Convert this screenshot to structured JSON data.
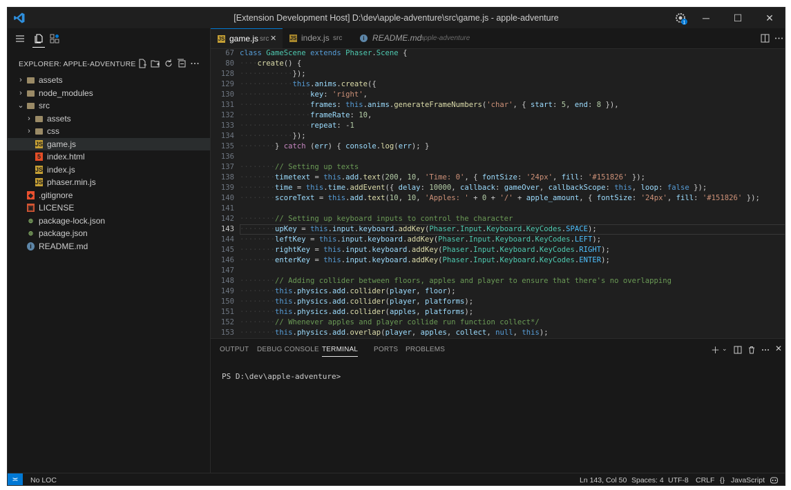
{
  "window": {
    "title": "[Extension Development Host] D:\\dev\\apple-adventure\\src\\game.js - apple-adventure",
    "controls": {
      "minimize": "─",
      "maximize": "☐",
      "close": "✕"
    },
    "accent": "#0078d4"
  },
  "explorer": {
    "title": "EXPLORER: APPLE-ADVENTURE",
    "tree": [
      {
        "label": "assets",
        "type": "folder",
        "depth": 0,
        "expanded": false
      },
      {
        "label": "node_modules",
        "type": "folder",
        "depth": 0,
        "expanded": false
      },
      {
        "label": "src",
        "type": "folder",
        "depth": 0,
        "expanded": true
      },
      {
        "label": "assets",
        "type": "folder",
        "depth": 1,
        "expanded": false
      },
      {
        "label": "css",
        "type": "folder",
        "depth": 1,
        "expanded": false
      },
      {
        "label": "game.js",
        "type": "js",
        "depth": 1,
        "selected": true
      },
      {
        "label": "index.html",
        "type": "html",
        "depth": 1
      },
      {
        "label": "index.js",
        "type": "js",
        "depth": 1
      },
      {
        "label": "phaser.min.js",
        "type": "js",
        "depth": 1
      },
      {
        "label": ".gitignore",
        "type": "git",
        "depth": 0
      },
      {
        "label": "LICENSE",
        "type": "license",
        "depth": 0
      },
      {
        "label": "package-lock.json",
        "type": "json",
        "depth": 0
      },
      {
        "label": "package.json",
        "type": "json",
        "depth": 0
      },
      {
        "label": "README.md",
        "type": "info",
        "depth": 0
      }
    ]
  },
  "tabs": [
    {
      "label": "game.js",
      "desc": "src",
      "active": true,
      "close": "✕"
    },
    {
      "label": "index.js",
      "desc": "src",
      "active": false
    },
    {
      "label": "README.md",
      "desc": "apple-adventure",
      "active": false
    }
  ],
  "editor": {
    "current_line": "143",
    "lines": [
      {
        "n": "67",
        "text": "class GameScene extends Phaser.Scene {"
      },
      {
        "n": "80",
        "text": "    create() {"
      },
      {
        "n": "128",
        "text": "            });"
      },
      {
        "n": "129",
        "text": "            this.anims.create({"
      },
      {
        "n": "130",
        "text": "                key: 'right',"
      },
      {
        "n": "131",
        "text": "                frames: this.anims.generateFrameNumbers('char', { start: 5, end: 8 }),"
      },
      {
        "n": "132",
        "text": "                frameRate: 10,"
      },
      {
        "n": "133",
        "text": "                repeat: -1"
      },
      {
        "n": "134",
        "text": "            });"
      },
      {
        "n": "135",
        "text": "        } catch (err) { console.log(err); }"
      },
      {
        "n": "136",
        "text": ""
      },
      {
        "n": "137",
        "text": "        // Setting up texts"
      },
      {
        "n": "138",
        "text": "        timetext = this.add.text(200, 10, 'Time: 0', { fontSize: '24px', fill: '#151826' });"
      },
      {
        "n": "139",
        "text": "        time = this.time.addEvent({ delay: 10000, callback: gameOver, callbackScope: this, loop: false });"
      },
      {
        "n": "140",
        "text": "        scoreText = this.add.text(10, 10, 'Apples: ' + 0 + '/' + apple_amount, { fontSize: '24px', fill: '#151826' });"
      },
      {
        "n": "141",
        "text": ""
      },
      {
        "n": "142",
        "text": "        // Setting up keyboard inputs to control the character"
      },
      {
        "n": "143",
        "text": "        upKey = this.input.keyboard.addKey(Phaser.Input.Keyboard.KeyCodes.SPACE);"
      },
      {
        "n": "144",
        "text": "        leftKey = this.input.keyboard.addKey(Phaser.Input.Keyboard.KeyCodes.LEFT);"
      },
      {
        "n": "145",
        "text": "        rightKey = this.input.keyboard.addKey(Phaser.Input.Keyboard.KeyCodes.RIGHT);"
      },
      {
        "n": "146",
        "text": "        enterKey = this.input.keyboard.addKey(Phaser.Input.Keyboard.KeyCodes.ENTER);"
      },
      {
        "n": "147",
        "text": ""
      },
      {
        "n": "148",
        "text": "        // Adding collider between floors, apples and player to ensure that there's no overlapping"
      },
      {
        "n": "149",
        "text": "        this.physics.add.collider(player, floor);"
      },
      {
        "n": "150",
        "text": "        this.physics.add.collider(player, platforms);"
      },
      {
        "n": "151",
        "text": "        this.physics.add.collider(apples, platforms);"
      },
      {
        "n": "152",
        "text": "        // Whenever apples and player collide run function collect*/"
      },
      {
        "n": "153",
        "text": "        this.physics.add.overlap(player, apples, collect, null, this);"
      }
    ]
  },
  "panel": {
    "tabs": [
      "OUTPUT",
      "DEBUG CONSOLE",
      "TERMINAL",
      "PORTS",
      "PROBLEMS"
    ],
    "active_tab": "TERMINAL",
    "terminal_prompt": "PS D:\\dev\\apple-adventure>"
  },
  "status": {
    "remote": "≍",
    "loc": "No LOC",
    "position": "Ln 143, Col 50",
    "spaces": "Spaces: 4",
    "encoding": "UTF-8",
    "eol": "CRLF",
    "language_icon": "{}",
    "language": "JavaScript"
  }
}
